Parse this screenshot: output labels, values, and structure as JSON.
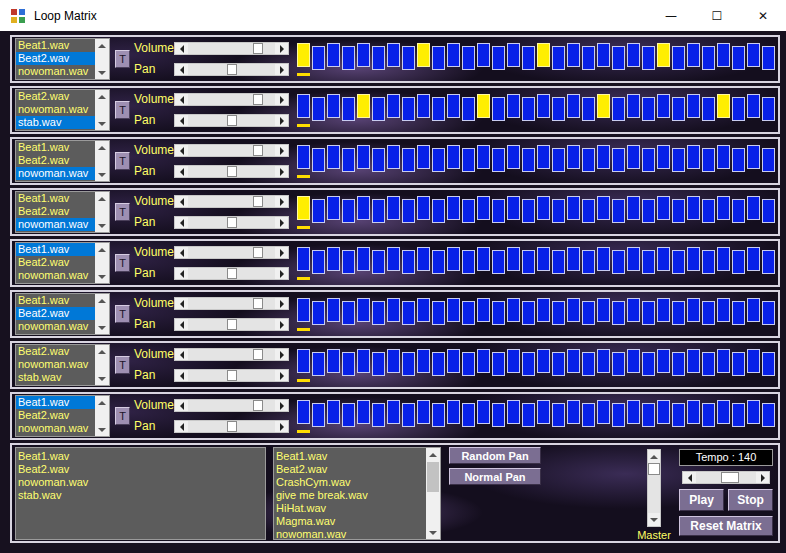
{
  "window": {
    "title": "Loop Matrix",
    "controls": [
      "—",
      "☐",
      "✕"
    ]
  },
  "tracks": [
    {
      "samples": [
        {
          "name": "Beat1.wav",
          "selected": false
        },
        {
          "name": "Beat2.wav",
          "selected": true
        },
        {
          "name": "nowoman.wav",
          "selected": false
        }
      ],
      "toggle": "T",
      "volume": {
        "label": "Volume",
        "level": 0.85
      },
      "pan": {
        "label": "Pan",
        "level": 0.5
      },
      "current_step": 0,
      "steps": [
        true,
        false,
        false,
        false,
        false,
        false,
        false,
        false,
        true,
        false,
        false,
        false,
        false,
        false,
        false,
        false,
        true,
        false,
        false,
        false,
        false,
        false,
        false,
        false,
        true,
        false,
        false,
        false,
        false,
        false,
        false,
        false
      ]
    },
    {
      "samples": [
        {
          "name": "Beat2.wav",
          "selected": false
        },
        {
          "name": "nowoman.wav",
          "selected": false
        },
        {
          "name": "stab.wav",
          "selected": true
        }
      ],
      "toggle": "T",
      "volume": {
        "label": "Volume",
        "level": 0.85
      },
      "pan": {
        "label": "Pan",
        "level": 0.5
      },
      "current_step": 0,
      "steps": [
        false,
        false,
        false,
        false,
        true,
        false,
        false,
        false,
        false,
        false,
        false,
        false,
        true,
        false,
        false,
        false,
        false,
        false,
        false,
        false,
        true,
        false,
        false,
        false,
        false,
        false,
        false,
        false,
        true,
        false,
        false,
        false
      ]
    },
    {
      "samples": [
        {
          "name": "Beat1.wav",
          "selected": false
        },
        {
          "name": "Beat2.wav",
          "selected": false
        },
        {
          "name": "nowoman.wav",
          "selected": true
        }
      ],
      "toggle": "T",
      "volume": {
        "label": "Volume",
        "level": 0.85
      },
      "pan": {
        "label": "Pan",
        "level": 0.5
      },
      "current_step": 0,
      "steps": [
        false,
        false,
        false,
        false,
        false,
        false,
        false,
        false,
        false,
        false,
        false,
        false,
        false,
        false,
        false,
        false,
        false,
        false,
        false,
        false,
        false,
        false,
        false,
        false,
        false,
        false,
        false,
        false,
        false,
        false,
        false,
        false
      ]
    },
    {
      "samples": [
        {
          "name": "Beat1.wav",
          "selected": false
        },
        {
          "name": "Beat2.wav",
          "selected": false
        },
        {
          "name": "nowoman.wav",
          "selected": true
        }
      ],
      "toggle": "T",
      "volume": {
        "label": "Volume",
        "level": 0.85
      },
      "pan": {
        "label": "Pan",
        "level": 0.5
      },
      "current_step": 0,
      "steps": [
        true,
        false,
        false,
        false,
        false,
        false,
        false,
        false,
        false,
        false,
        false,
        false,
        false,
        false,
        false,
        false,
        false,
        false,
        false,
        false,
        false,
        false,
        false,
        false,
        false,
        false,
        false,
        false,
        false,
        false,
        false,
        false
      ]
    },
    {
      "samples": [
        {
          "name": "Beat1.wav",
          "selected": true
        },
        {
          "name": "Beat2.wav",
          "selected": false
        },
        {
          "name": "nowoman.wav",
          "selected": false
        }
      ],
      "toggle": "T",
      "volume": {
        "label": "Volume",
        "level": 0.85
      },
      "pan": {
        "label": "Pan",
        "level": 0.5
      },
      "current_step": 0,
      "steps": [
        false,
        false,
        false,
        false,
        false,
        false,
        false,
        false,
        false,
        false,
        false,
        false,
        false,
        false,
        false,
        false,
        false,
        false,
        false,
        false,
        false,
        false,
        false,
        false,
        false,
        false,
        false,
        false,
        false,
        false,
        false,
        false
      ]
    },
    {
      "samples": [
        {
          "name": "Beat1.wav",
          "selected": false
        },
        {
          "name": "Beat2.wav",
          "selected": true
        },
        {
          "name": "nowoman.wav",
          "selected": false
        }
      ],
      "toggle": "T",
      "volume": {
        "label": "Volume",
        "level": 0.85
      },
      "pan": {
        "label": "Pan",
        "level": 0.5
      },
      "current_step": 0,
      "steps": [
        false,
        false,
        false,
        false,
        false,
        false,
        false,
        false,
        false,
        false,
        false,
        false,
        false,
        false,
        false,
        false,
        false,
        false,
        false,
        false,
        false,
        false,
        false,
        false,
        false,
        false,
        false,
        false,
        false,
        false,
        false,
        false
      ]
    },
    {
      "samples": [
        {
          "name": "Beat2.wav",
          "selected": false
        },
        {
          "name": "nowoman.wav",
          "selected": false
        },
        {
          "name": "stab.wav",
          "selected": false
        }
      ],
      "toggle": "T",
      "volume": {
        "label": "Volume",
        "level": 0.85
      },
      "pan": {
        "label": "Pan",
        "level": 0.5
      },
      "current_step": 0,
      "steps": [
        false,
        false,
        false,
        false,
        false,
        false,
        false,
        false,
        false,
        false,
        false,
        false,
        false,
        false,
        false,
        false,
        false,
        false,
        false,
        false,
        false,
        false,
        false,
        false,
        false,
        false,
        false,
        false,
        false,
        false,
        false,
        false
      ]
    },
    {
      "samples": [
        {
          "name": "Beat1.wav",
          "selected": true
        },
        {
          "name": "Beat2.wav",
          "selected": false
        },
        {
          "name": "nowoman.wav",
          "selected": false
        }
      ],
      "toggle": "T",
      "volume": {
        "label": "Volume",
        "level": 0.85
      },
      "pan": {
        "label": "Pan",
        "level": 0.5
      },
      "current_step": 0,
      "steps": [
        false,
        false,
        false,
        false,
        false,
        false,
        false,
        false,
        false,
        false,
        false,
        false,
        false,
        false,
        false,
        false,
        false,
        false,
        false,
        false,
        false,
        false,
        false,
        false,
        false,
        false,
        false,
        false,
        false,
        false,
        false,
        false
      ]
    }
  ],
  "loaded_samples": [
    "Beat1.wav",
    "Beat2.wav",
    "nowoman.wav",
    "stab.wav"
  ],
  "library": {
    "items": [
      "Beat1.wav",
      "Beat2.wav",
      "CrashCym.wav",
      "give me break.wav",
      "HiHat.wav",
      "Magma.wav",
      "nowoman.wav"
    ],
    "scrollbar": {
      "level": 0
    }
  },
  "pan_buttons": [
    "Random Pan",
    "Normal Pan"
  ],
  "master": {
    "label": "Master",
    "level": 1
  },
  "tempo": {
    "reading": "Tempo : 140",
    "level": 0.6
  },
  "transport": [
    "Play",
    "Stop"
  ],
  "reset": "Reset Matrix"
}
